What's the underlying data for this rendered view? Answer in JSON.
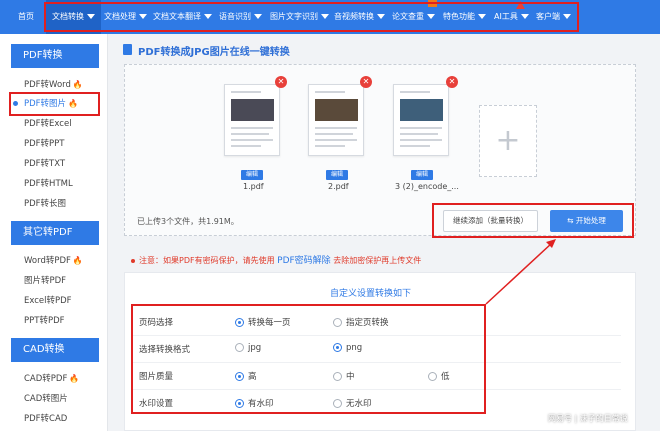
{
  "nav": {
    "items": [
      {
        "label": "首页",
        "caret": false
      },
      {
        "label": "文档转换",
        "caret": true
      },
      {
        "label": "文档处理",
        "caret": true
      },
      {
        "label": "文档文本翻译",
        "caret": true
      },
      {
        "label": "语音识别",
        "caret": true
      },
      {
        "label": "图片文字识别",
        "caret": true
      },
      {
        "label": "音视频转换",
        "caret": true
      },
      {
        "label": "论文查重",
        "caret": true
      },
      {
        "label": "特色功能",
        "caret": true
      },
      {
        "label": "AI工具",
        "caret": true
      },
      {
        "label": "客户端",
        "caret": true
      }
    ]
  },
  "sidebar": {
    "sections": [
      {
        "title": "PDF转换",
        "items": [
          {
            "label": "PDF转Word",
            "hot": true
          },
          {
            "label": "PDF转图片",
            "hot": true,
            "active": true
          },
          {
            "label": "PDF转Excel"
          },
          {
            "label": "PDF转PPT"
          },
          {
            "label": "PDF转TXT"
          },
          {
            "label": "PDF转HTML"
          },
          {
            "label": "PDF转长图"
          }
        ]
      },
      {
        "title": "其它转PDF",
        "items": [
          {
            "label": "Word转PDF",
            "hot": true
          },
          {
            "label": "图片转PDF"
          },
          {
            "label": "Excel转PDF"
          },
          {
            "label": "PPT转PDF"
          }
        ]
      },
      {
        "title": "CAD转换",
        "items": [
          {
            "label": "CAD转PDF",
            "hot": true
          },
          {
            "label": "CAD转图片"
          },
          {
            "label": "PDF转CAD"
          }
        ]
      }
    ],
    "hot_icon": "fire-icon"
  },
  "main": {
    "title": "PDF转换成JPG图片在线一键转换",
    "files": [
      {
        "name": "1.pdf",
        "edit": "编辑"
      },
      {
        "name": "2.pdf",
        "edit": "编辑"
      },
      {
        "name": "3 (2)_encode_...",
        "edit": "编辑"
      }
    ],
    "upload_status": "已上传3个文件，共1.91M。",
    "continue_button": "继续添加（批量转换）",
    "start_button": "开始处理"
  },
  "notice": {
    "prefix": "注意：如果PDF有密码保护，请先使用",
    "link": "PDF密码解除",
    "suffix": "去除加密保护再上传文件"
  },
  "settings": {
    "title": "自定义设置转换如下",
    "rows": [
      {
        "label": "页码选择",
        "options": [
          {
            "text": "转换每一页",
            "checked": true
          },
          {
            "text": "指定页转换",
            "checked": false
          }
        ]
      },
      {
        "label": "选择转换格式",
        "options": [
          {
            "text": "jpg",
            "checked": false
          },
          {
            "text": "png",
            "checked": true
          }
        ]
      },
      {
        "label": "图片质量",
        "options": [
          {
            "text": "高",
            "checked": true
          },
          {
            "text": "中",
            "checked": false
          },
          {
            "text": "低",
            "checked": false
          }
        ]
      },
      {
        "label": "水印设置",
        "options": [
          {
            "text": "有水印",
            "checked": true
          },
          {
            "text": "无水印",
            "checked": false
          }
        ]
      }
    ]
  },
  "watermark": "网易号 | 沫子的日常说",
  "colors": {
    "accent": "#2f7ae5",
    "annotation": "#e02020",
    "hot": "#f07a1a"
  }
}
